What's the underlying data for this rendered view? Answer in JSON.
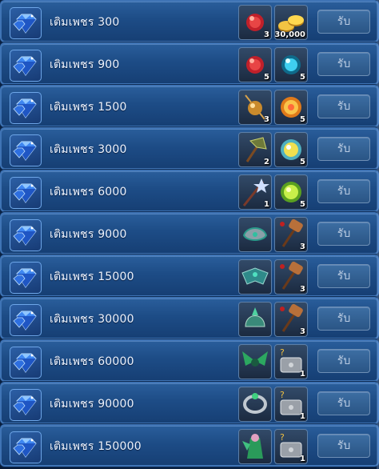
{
  "rows": [
    {
      "label": "เติมเพชร 300",
      "r1": {
        "icon": "red-orb-icon",
        "qty": "3"
      },
      "r2": {
        "icon": "gold-coins-icon",
        "qty": "30,000"
      },
      "claim": "รับ"
    },
    {
      "label": "เติมเพชร 900",
      "r1": {
        "icon": "red-orb-icon",
        "qty": "5"
      },
      "r2": {
        "icon": "blue-orb-icon",
        "qty": "5"
      },
      "claim": "รับ"
    },
    {
      "label": "เติมเพชร 1500",
      "r1": {
        "icon": "gold-orb-staff-icon",
        "qty": "3"
      },
      "r2": {
        "icon": "fire-orb-icon",
        "qty": "5"
      },
      "claim": "รับ"
    },
    {
      "label": "เติมเพชร 3000",
      "r1": {
        "icon": "battle-axe-icon",
        "qty": "2"
      },
      "r2": {
        "icon": "yellow-orb-icon",
        "qty": "5"
      },
      "claim": "รับ"
    },
    {
      "label": "เติมเพชร 6000",
      "r1": {
        "icon": "star-scepter-icon",
        "qty": "1"
      },
      "r2": {
        "icon": "green-orb-icon",
        "qty": "5"
      },
      "claim": "รับ"
    },
    {
      "label": "เติมเพชร 9000",
      "r1": {
        "icon": "armor-bracer-icon",
        "qty": ""
      },
      "r2": {
        "icon": "war-hammer-icon",
        "qty": "3"
      },
      "claim": "รับ"
    },
    {
      "label": "เติมเพชร 15000",
      "r1": {
        "icon": "winged-armor-icon",
        "qty": ""
      },
      "r2": {
        "icon": "war-hammer-icon",
        "qty": "3"
      },
      "claim": "รับ"
    },
    {
      "label": "เติมเพชร 30000",
      "r1": {
        "icon": "ornate-helm-icon",
        "qty": ""
      },
      "r2": {
        "icon": "war-hammer-icon",
        "qty": "3"
      },
      "claim": "รับ"
    },
    {
      "label": "เติมเพชร 60000",
      "r1": {
        "icon": "green-wings-icon",
        "qty": ""
      },
      "r2": {
        "icon": "mystery-chest-icon",
        "qty": "1"
      },
      "claim": "รับ"
    },
    {
      "label": "เติมเพชร 90000",
      "r1": {
        "icon": "jeweled-ring-icon",
        "qty": ""
      },
      "r2": {
        "icon": "mystery-chest-icon",
        "qty": "1"
      },
      "claim": "รับ"
    },
    {
      "label": "เติมเพชร 150000",
      "r1": {
        "icon": "emerald-costume-icon",
        "qty": ""
      },
      "r2": {
        "icon": "mystery-chest-icon",
        "qty": "1"
      },
      "claim": "รับ"
    }
  ],
  "colors": {
    "row_border": "#3f74b5",
    "row_fill": "#1d4c86",
    "claim_text": "#b9cbe2",
    "gem_blue": "#2f6fd6"
  }
}
